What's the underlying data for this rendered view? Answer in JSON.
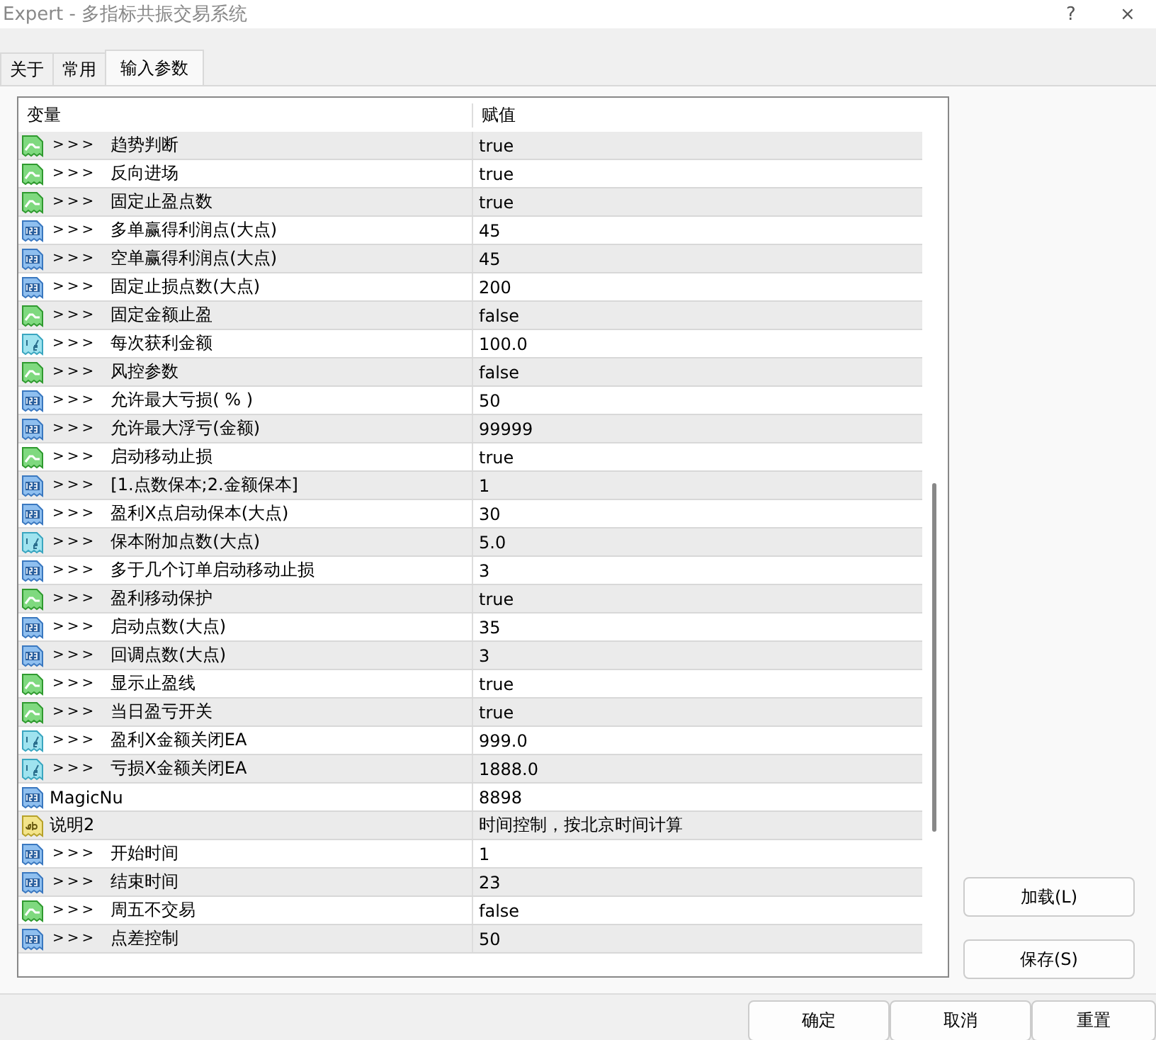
{
  "window": {
    "title": "Expert - 多指标共振交易系统",
    "help": "?",
    "close": "×"
  },
  "tabs": [
    {
      "label": "关于",
      "selected": false
    },
    {
      "label": "常用",
      "selected": false
    },
    {
      "label": "输入参数",
      "selected": true
    }
  ],
  "table": {
    "columns": [
      "变量",
      "赋值"
    ],
    "rows": [
      {
        "kind": "bool",
        "prefix": ">>>",
        "name": "趋势判断",
        "value": "true"
      },
      {
        "kind": "bool",
        "prefix": ">>>",
        "name": "反向进场",
        "value": "true"
      },
      {
        "kind": "bool",
        "prefix": ">>>",
        "name": "固定止盈点数",
        "value": "true"
      },
      {
        "kind": "int",
        "prefix": ">>>",
        "name": "多单赢得利润点(大点)",
        "value": "45"
      },
      {
        "kind": "int",
        "prefix": ">>>",
        "name": "空单赢得利润点(大点)",
        "value": "45"
      },
      {
        "kind": "int",
        "prefix": ">>>",
        "name": "固定止损点数(大点)",
        "value": "200"
      },
      {
        "kind": "bool",
        "prefix": ">>>",
        "name": "固定金额止盈",
        "value": "false"
      },
      {
        "kind": "double",
        "prefix": ">>>",
        "name": "每次获利金额",
        "value": "100.0"
      },
      {
        "kind": "bool",
        "prefix": ">>>",
        "name": "风控参数",
        "value": "false"
      },
      {
        "kind": "int",
        "prefix": ">>>",
        "name": "允许最大亏损( % )",
        "value": "50"
      },
      {
        "kind": "int",
        "prefix": ">>>",
        "name": "允许最大浮亏(金额)",
        "value": "99999"
      },
      {
        "kind": "bool",
        "prefix": ">>>",
        "name": "启动移动止损",
        "value": "true"
      },
      {
        "kind": "int",
        "prefix": ">>>",
        "name": "[1.点数保本;2.金额保本]",
        "value": "1"
      },
      {
        "kind": "int",
        "prefix": ">>>",
        "name": "盈利X点启动保本(大点)",
        "value": "30"
      },
      {
        "kind": "double",
        "prefix": ">>>",
        "name": "保本附加点数(大点)",
        "value": "5.0"
      },
      {
        "kind": "int",
        "prefix": ">>>",
        "name": "多于几个订单启动移动止损",
        "value": "3"
      },
      {
        "kind": "bool",
        "prefix": ">>>",
        "name": "盈利移动保护",
        "value": "true"
      },
      {
        "kind": "int",
        "prefix": ">>>",
        "name": "启动点数(大点)",
        "value": "35"
      },
      {
        "kind": "int",
        "prefix": ">>>",
        "name": "回调点数(大点)",
        "value": "3"
      },
      {
        "kind": "bool",
        "prefix": ">>>",
        "name": "显示止盈线",
        "value": "true"
      },
      {
        "kind": "bool",
        "prefix": ">>>",
        "name": "当日盈亏开关",
        "value": "true"
      },
      {
        "kind": "double",
        "prefix": ">>>",
        "name": "盈利X金额关闭EA",
        "value": "999.0"
      },
      {
        "kind": "double",
        "prefix": ">>>",
        "name": "亏损X金额关闭EA",
        "value": "1888.0"
      },
      {
        "kind": "int",
        "name": "MagicNu",
        "value": "8898"
      },
      {
        "kind": "string",
        "name": "说明2",
        "value": "时间控制，按北京时间计算"
      },
      {
        "kind": "int",
        "prefix": ">>>",
        "name": "开始时间",
        "value": "1"
      },
      {
        "kind": "int",
        "prefix": ">>>",
        "name": "结束时间",
        "value": "23"
      },
      {
        "kind": "bool",
        "prefix": ">>>",
        "name": "周五不交易",
        "value": "false"
      },
      {
        "kind": "int",
        "prefix": ">>>",
        "name": "点差控制",
        "value": "50"
      }
    ]
  },
  "side_buttons": [
    "加载(L)",
    "保存(S)"
  ],
  "buttons": [
    "确定",
    "取消",
    "重置"
  ]
}
